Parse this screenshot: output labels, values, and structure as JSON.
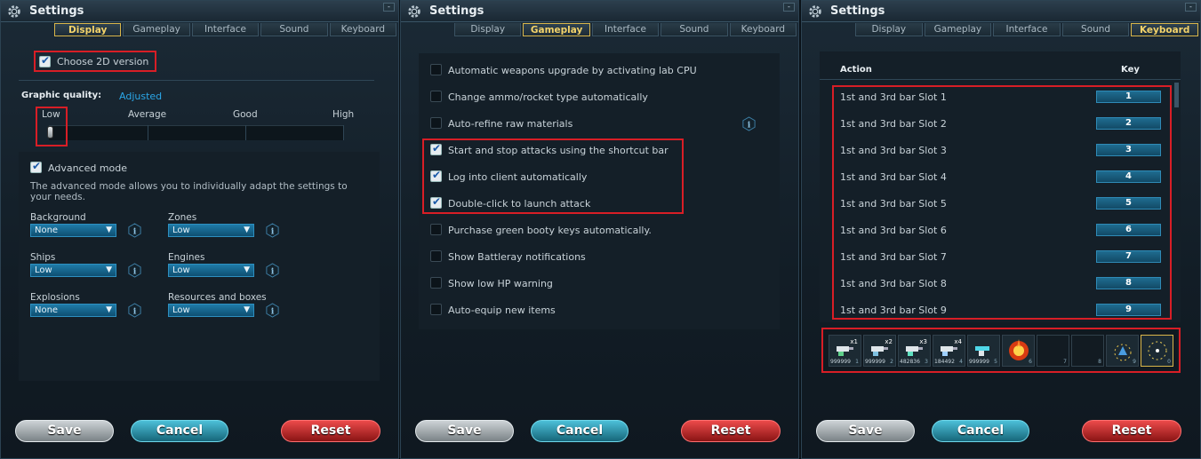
{
  "window_title": "Settings",
  "minimize_label": "-",
  "tabs": [
    "Display",
    "Gameplay",
    "Interface",
    "Sound",
    "Keyboard"
  ],
  "buttons": {
    "save": "Save",
    "cancel": "Cancel",
    "reset": "Reset"
  },
  "display": {
    "choose_2d": {
      "label": "Choose 2D version",
      "checked": true
    },
    "graphic_quality_label": "Graphic quality:",
    "graphic_quality_value": "Adjusted",
    "quality_levels": [
      "Low",
      "Average",
      "Good",
      "High"
    ],
    "advanced_mode": {
      "label": "Advanced mode",
      "checked": true
    },
    "advanced_desc": "The advanced mode allows you to individually adapt the settings to your needs.",
    "options": [
      {
        "label": "Background",
        "value": "None"
      },
      {
        "label": "Zones",
        "value": "Low"
      },
      {
        "label": "Ships",
        "value": "Low"
      },
      {
        "label": "Engines",
        "value": "Low"
      },
      {
        "label": "Explosions",
        "value": "None"
      },
      {
        "label": "Resources and boxes",
        "value": "Low"
      }
    ]
  },
  "gameplay": {
    "items": [
      {
        "label": "Automatic weapons upgrade by activating lab CPU",
        "checked": false
      },
      {
        "label": "Change ammo/rocket type automatically",
        "checked": false
      },
      {
        "label": "Auto-refine raw materials",
        "checked": false
      },
      {
        "label": "Start and stop attacks using the shortcut bar",
        "checked": true
      },
      {
        "label": "Log into client automatically",
        "checked": true
      },
      {
        "label": "Double-click to launch attack",
        "checked": true
      },
      {
        "label": "Purchase green booty keys automatically.",
        "checked": false
      },
      {
        "label": "Show Battleray notifications",
        "checked": false
      },
      {
        "label": "Show low HP warning",
        "checked": false
      },
      {
        "label": "Auto-equip new items",
        "checked": false
      }
    ]
  },
  "keyboard": {
    "col_action": "Action",
    "col_key": "Key",
    "rows": [
      {
        "action": "1st and 3rd bar Slot 1",
        "key": "1"
      },
      {
        "action": "1st and 3rd bar Slot 2",
        "key": "2"
      },
      {
        "action": "1st and 3rd bar Slot 3",
        "key": "3"
      },
      {
        "action": "1st and 3rd bar Slot 4",
        "key": "4"
      },
      {
        "action": "1st and 3rd bar Slot 5",
        "key": "5"
      },
      {
        "action": "1st and 3rd bar Slot 6",
        "key": "6"
      },
      {
        "action": "1st and 3rd bar Slot 7",
        "key": "7"
      },
      {
        "action": "1st and 3rd bar Slot 8",
        "key": "8"
      },
      {
        "action": "1st and 3rd bar Slot 9",
        "key": "9"
      }
    ],
    "slots": [
      {
        "num": "1",
        "count": "999999",
        "mult": "x1"
      },
      {
        "num": "2",
        "count": "999999",
        "mult": "x2"
      },
      {
        "num": "3",
        "count": "482836",
        "mult": "x3"
      },
      {
        "num": "4",
        "count": "184492",
        "mult": "x4"
      },
      {
        "num": "5",
        "count": "999999",
        "mult": ""
      },
      {
        "num": "6",
        "count": "",
        "mult": ""
      },
      {
        "num": "7",
        "count": "",
        "mult": ""
      },
      {
        "num": "8",
        "count": "",
        "mult": ""
      },
      {
        "num": "9",
        "count": "",
        "mult": ""
      },
      {
        "num": "0",
        "count": "",
        "mult": ""
      }
    ]
  },
  "colors": {
    "highlight_red": "#d81e26",
    "active_tab": "#d9b64a",
    "link_blue": "#2ba7e8"
  }
}
